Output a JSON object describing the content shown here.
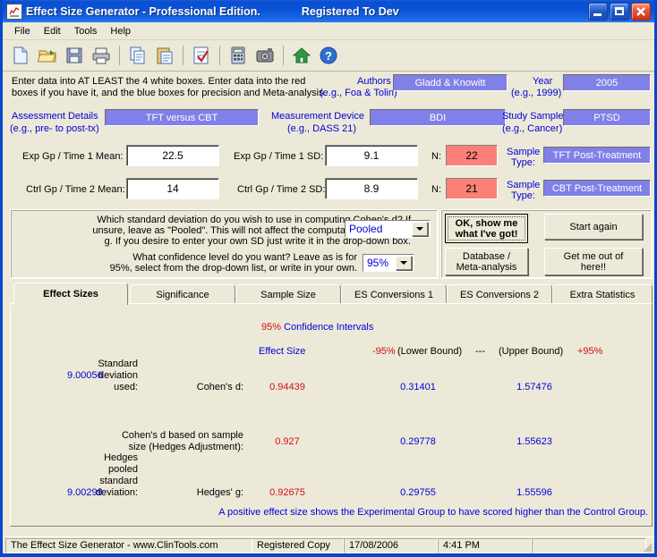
{
  "window": {
    "title": "Effect Size Generator  - Professional Edition.",
    "registration": "Registered To Dev",
    "icon": "chart-icon",
    "minimize_label": "_",
    "maximize_label": "□",
    "close_label": "✕"
  },
  "menu": {
    "items": [
      {
        "label": "File"
      },
      {
        "label": "Edit"
      },
      {
        "label": "Tools"
      },
      {
        "label": "Help"
      }
    ]
  },
  "toolbar": {
    "buttons": [
      {
        "name": "new-icon"
      },
      {
        "name": "open-folder-icon"
      },
      {
        "name": "save-floppy-icon"
      },
      {
        "name": "print-icon"
      },
      {
        "name": "copy-icon"
      },
      {
        "name": "paste-icon"
      },
      {
        "name": "checklist-icon"
      },
      {
        "name": "calculator-icon"
      },
      {
        "name": "camera-icon"
      },
      {
        "name": "home-icon"
      },
      {
        "name": "help-icon"
      }
    ]
  },
  "instructions": {
    "line1": "Enter data into AT LEAST the 4 white boxes. Enter data into the red",
    "line2": "boxes if you have it, and the blue boxes for precision and Meta-analysis."
  },
  "study_info": {
    "authors": {
      "label": "Authors",
      "hint": "(e.g., Foa & Tolin)",
      "value": "Gladd & Knowitt"
    },
    "year": {
      "label": "Year",
      "hint": "(e.g., 1999)",
      "value": "2005"
    },
    "assessment": {
      "label": "Assessment Details",
      "hint": "(e.g., pre- to post-tx)",
      "value": "TFT versus CBT"
    },
    "device": {
      "label": "Measurement Device",
      "hint": "(e.g., DASS 21)",
      "value": "BDI"
    },
    "sample": {
      "label": "Study Sample",
      "hint": "(e.g., Cancer)",
      "value": "PTSD"
    }
  },
  "data_entry": {
    "row1": {
      "mean_label": "Exp Gp / Time 1 Mean:",
      "mean_value": "22.5",
      "sd_label": "Exp Gp / Time 1 SD:",
      "sd_value": "9.1",
      "n_label": "N:",
      "n_value": "22",
      "sample_type_label1": "Sample",
      "sample_type_label2": "Type:",
      "sample_type_value": "TFT Post-Treatment"
    },
    "row2": {
      "mean_label": "Ctrl Gp / Time 2 Mean:",
      "mean_value": "14",
      "sd_label": "Ctrl Gp / Time 2 SD:",
      "sd_value": "8.9",
      "n_label": "N:",
      "n_value": "21",
      "sample_type_label1": "Sample",
      "sample_type_label2": "Type:",
      "sample_type_value": "CBT Post-Treatment"
    }
  },
  "options": {
    "sd_question_l1": "Which standard deviation do you wish to use in computing Cohen's d? If",
    "sd_question_l2": "unsure, leave as \"Pooled\". This will not affect the computation of Hedges'",
    "sd_question_l3": "g. If you desire to enter your own SD just write it in the drop-down box.",
    "sd_value": "Pooled",
    "ci_question_l1": "What confidence level do you want? Leave as is for",
    "ci_question_l2": "95%, select from the drop-down list, or write in your own.",
    "ci_value": "95%"
  },
  "buttons": {
    "ok_l1": "OK, show me",
    "ok_l2": "what I've got!",
    "start_again": "Start again",
    "database_l1": "Database /",
    "database_l2": "Meta-analysis",
    "exit_l1": "Get me out of",
    "exit_l2": "here!!"
  },
  "tabs": [
    {
      "label": "Effect Sizes",
      "active": true
    },
    {
      "label": "Significance",
      "active": false
    },
    {
      "label": "Sample Size",
      "active": false
    },
    {
      "label": "ES Conversions 1",
      "active": false
    },
    {
      "label": "ES Conversions 2",
      "active": false
    },
    {
      "label": "Extra Statistics",
      "active": false
    }
  ],
  "results": {
    "ci_title_pct": "95%",
    "ci_title_rest": " Confidence Intervals",
    "col_effect_size": "Effect Size",
    "col_lower_pct": "-95%",
    "col_lower_text": "(Lower Bound)",
    "col_dash": "---",
    "col_upper_text": "(Upper Bound)",
    "col_upper_pct": "+95%",
    "sd_used_l1": "Standard",
    "sd_used_l2": "deviation",
    "sd_used_l3": "used:",
    "sd_used_value": "9.00056",
    "hedges_sd_l1": "Hedges",
    "hedges_sd_l2": "pooled",
    "hedges_sd_l3": "standard",
    "hedges_sd_l4": "deviation:",
    "hedges_sd_value": "9.00299",
    "rows": [
      {
        "label": "Cohen's d:",
        "label2": "",
        "effect_size": "0.94439",
        "lower": "0.31401",
        "upper": "1.57476"
      },
      {
        "label": "Cohen's d based on sample",
        "label2": "size (Hedges Adjustment):",
        "effect_size": "0.927",
        "lower": "0.29778",
        "upper": "1.55623"
      },
      {
        "label": "Hedges' g:",
        "label2": "",
        "effect_size": "0.92675",
        "lower": "0.29755",
        "upper": "1.55596"
      }
    ],
    "footnote": "A positive effect size shows the Experimental Group to have scored higher than the Control Group."
  },
  "statusbar": {
    "app": "The Effect Size Generator - www.ClinTools.com",
    "license": "Registered Copy",
    "date": "17/08/2006",
    "time": "4:41 PM",
    "extra": ""
  },
  "colors": {
    "blue_text": "#0000d8",
    "red_text": "#d01010",
    "blue_field": "#8080e8",
    "red_field": "#fa8078",
    "face": "#ece9d8",
    "title_blue": "#0a4fd0"
  }
}
